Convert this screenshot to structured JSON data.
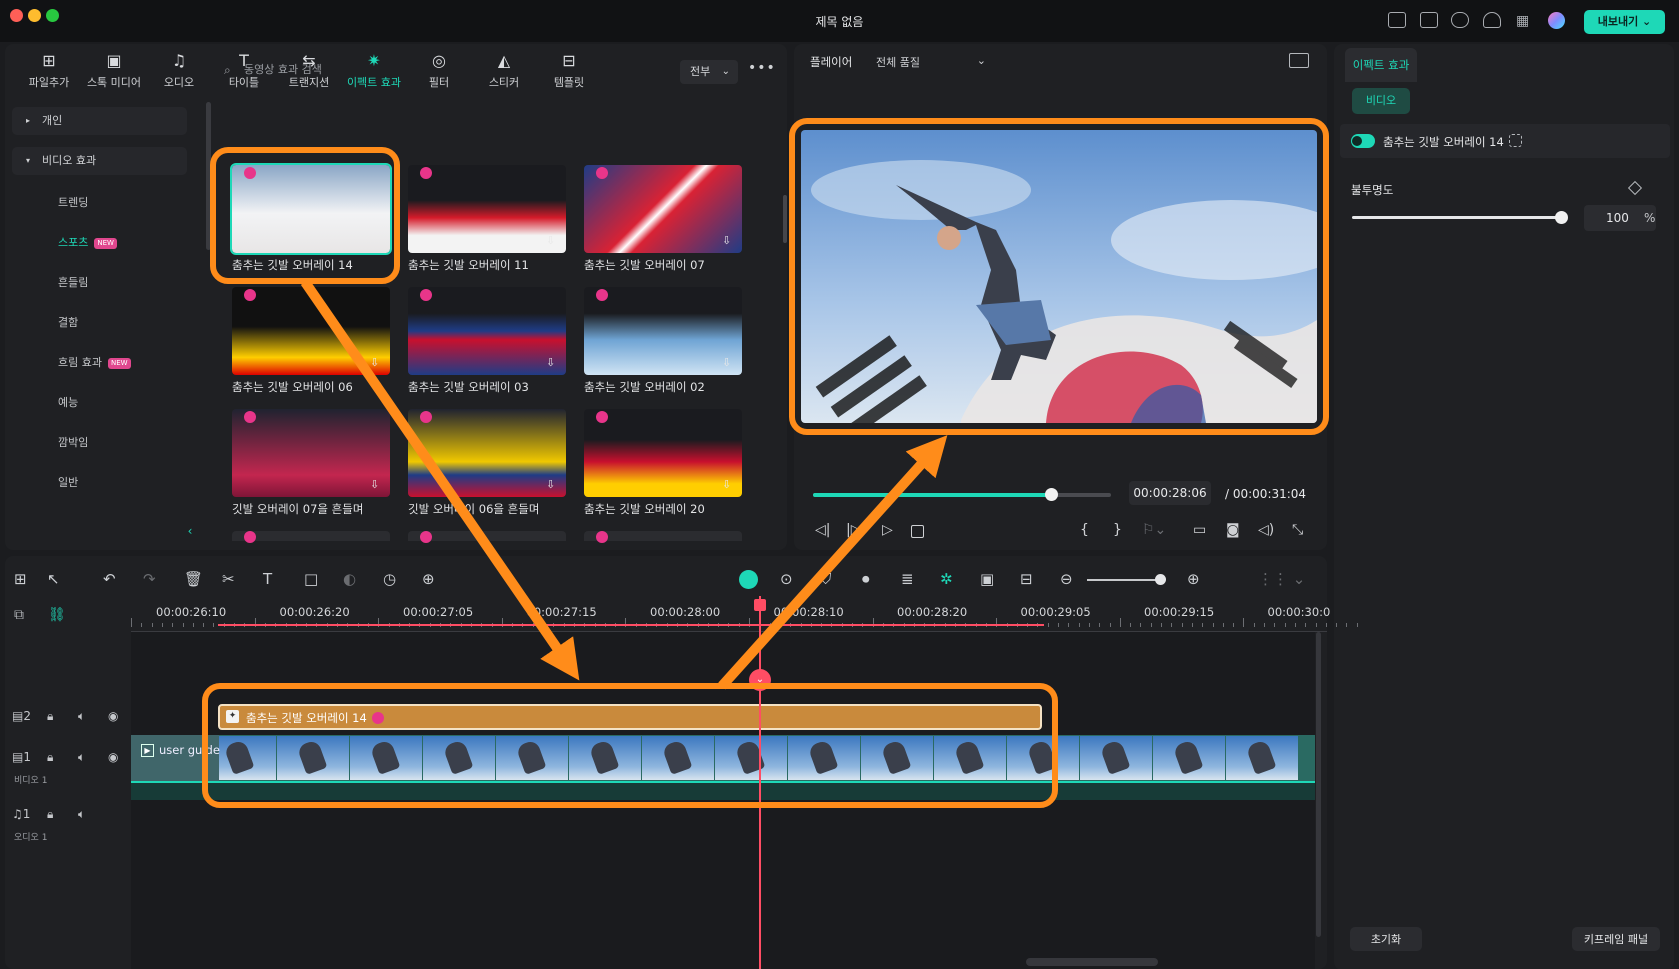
{
  "window": {
    "title": "제목 없음",
    "export_label": "내보내기"
  },
  "toolbar": [
    {
      "label": "파일추가",
      "icon": "import-icon"
    },
    {
      "label": "스톡 미디어",
      "icon": "stock-media-icon"
    },
    {
      "label": "오디오",
      "icon": "audio-icon"
    },
    {
      "label": "타이틀",
      "icon": "title-icon"
    },
    {
      "label": "트랜지션",
      "icon": "transition-icon"
    },
    {
      "label": "이펙트 효과",
      "icon": "effects-icon",
      "active": true
    },
    {
      "label": "필터",
      "icon": "filter-icon"
    },
    {
      "label": "스티커",
      "icon": "sticker-icon"
    },
    {
      "label": "템플릿",
      "icon": "template-icon"
    }
  ],
  "sidebar": {
    "group_personal": "개인",
    "group_video_effects": "비디오 효과",
    "items": [
      "트렌딩",
      "스포츠",
      "흔들림",
      "결함",
      "흐림 효과",
      "예능",
      "깜박임",
      "일반"
    ],
    "new_badge": "NEW"
  },
  "search": {
    "placeholder": "동영상 효과 검색",
    "filter": "전부"
  },
  "effects": [
    {
      "name": "춤추는 깃발 오버레이 14"
    },
    {
      "name": "춤추는 깃발 오버레이 11"
    },
    {
      "name": "춤추는 깃발 오버레이 07"
    },
    {
      "name": "춤추는 깃발 오버레이 06"
    },
    {
      "name": "춤추는 깃발 오버레이 03"
    },
    {
      "name": "춤추는 깃발 오버레이 02"
    },
    {
      "name": "깃발 오버레이 07을 흔들며"
    },
    {
      "name": "깃발 오버레이 06을 흔들며"
    },
    {
      "name": "춤추는 깃발 오버레이 20"
    }
  ],
  "player": {
    "label": "플레이어",
    "quality": "전체 품질",
    "current_time": "00:00:28:06",
    "total_time": "/ 00:00:31:04",
    "progress": 0.8
  },
  "properties": {
    "tab": "이펙트 효과",
    "subtab": "비디오",
    "effect_name": "춤추는 깃발 오버레이 14",
    "opacity_label": "불투명도",
    "opacity_value": "100",
    "opacity_unit": "%",
    "reset": "초기화",
    "keyframe_panel": "키프레임 패널"
  },
  "timeline": {
    "ticks": [
      "00:00:26:10",
      "00:00:26:20",
      "00:00:27:05",
      "00:00:27:15",
      "00:00:28:00",
      "00:00:28:10",
      "00:00:28:20",
      "00:00:29:05",
      "00:00:29:15",
      "00:00:30:0"
    ],
    "effect_clip": "춤추는 깃발 오버레이 14",
    "video_clip": "user guide",
    "track2_num": "2",
    "track1_num": "1",
    "track1_label": "비디오 1",
    "audio_num": "1",
    "audio_label": "오디오 1"
  },
  "colors": {
    "accent": "#1ed8b7",
    "highlight": "#ff8c1a",
    "playhead": "#ff4d64",
    "effect_clip": "#c98a3c"
  }
}
